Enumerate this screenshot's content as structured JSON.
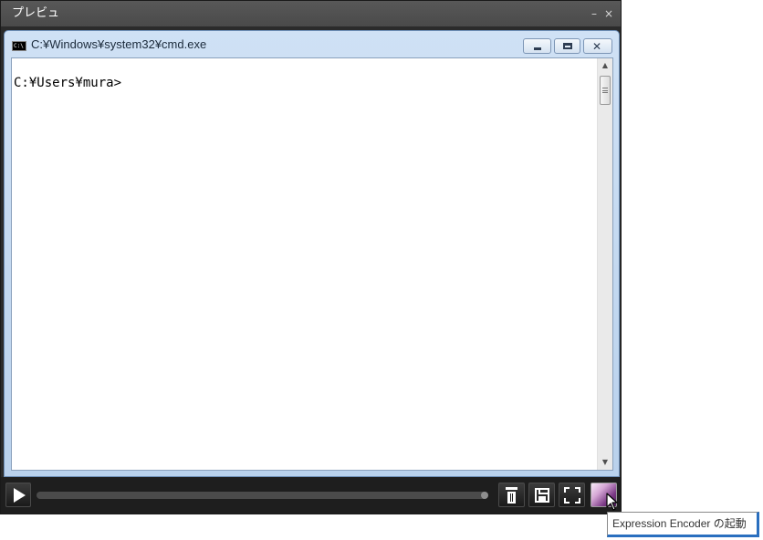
{
  "preview": {
    "title": "プレビュ",
    "minimize_glyph": "–",
    "close_glyph": "×"
  },
  "cmd_window": {
    "title": "C:¥Windows¥system32¥cmd.exe",
    "app_icon_text": "C:\\",
    "buttons": {
      "close_glyph": "✕"
    },
    "content_lines": [
      "C:¥Users¥mura>"
    ],
    "scrollbar": {
      "up_glyph": "▲",
      "down_glyph": "▼"
    }
  },
  "player": {
    "icons": [
      "play-icon",
      "trash-icon",
      "save-icon",
      "fullscreen-icon",
      "expression-encoder-icon"
    ],
    "seek_position": 1.0
  },
  "tooltip": {
    "text": "Expression Encoder の起動"
  },
  "colors": {
    "preview_bg": "#2b2b2b",
    "cmd_frame": "#cfe1f5",
    "tooltip_accent": "#2a6fbf"
  }
}
